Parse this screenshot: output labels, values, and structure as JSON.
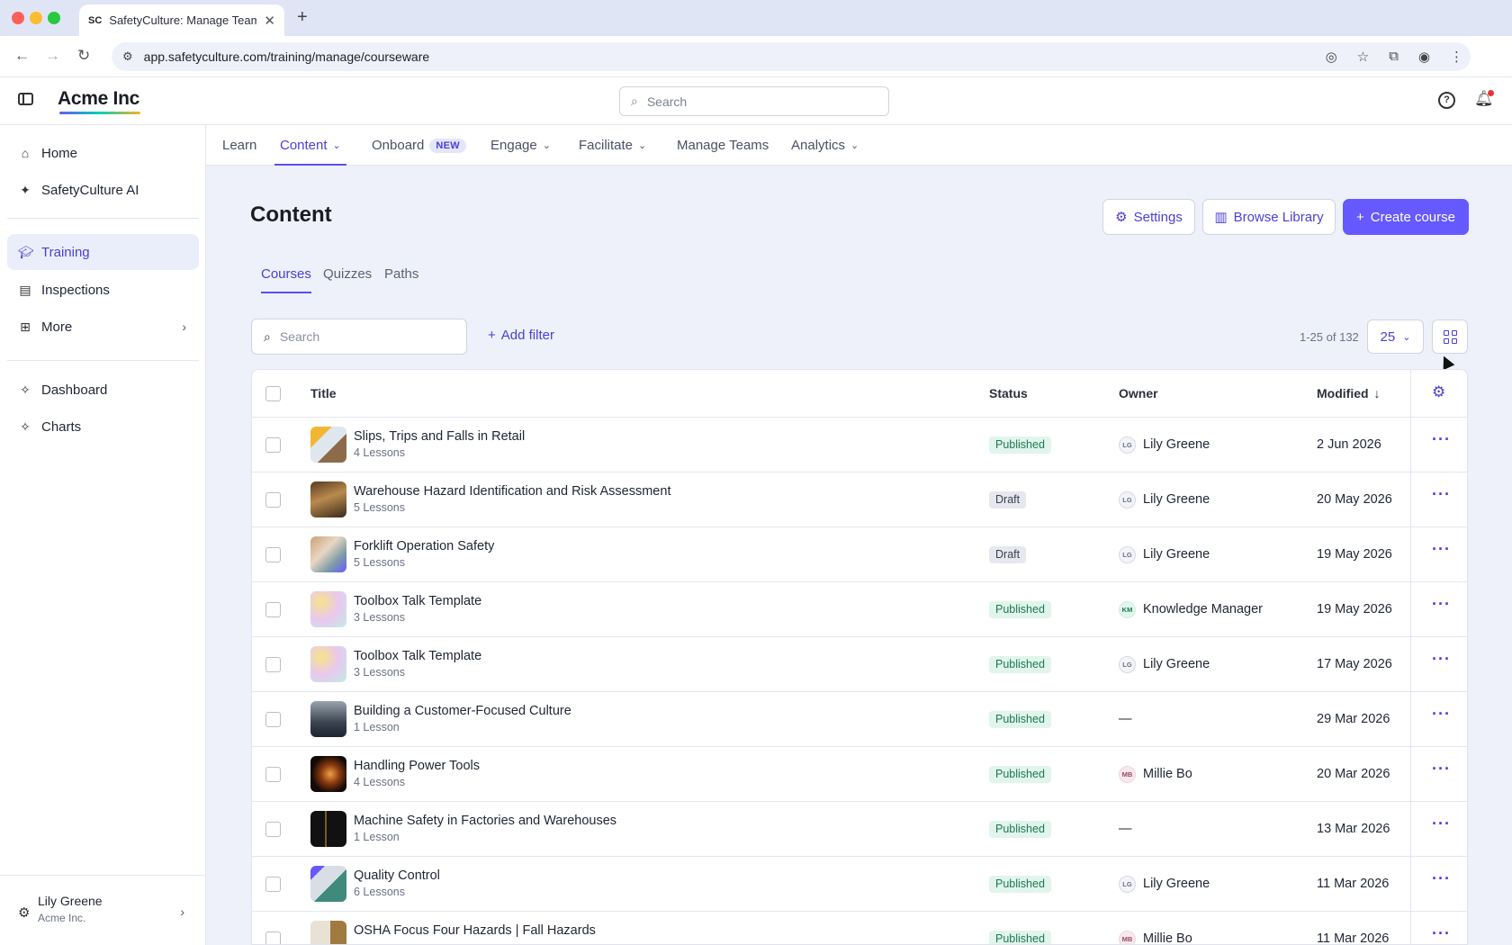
{
  "browser": {
    "tab_title": "SafetyCulture: Manage Teams",
    "favicon_text": "SC",
    "url": "app.safetyculture.com/training/manage/courseware"
  },
  "header": {
    "brand": "Acme Inc",
    "search_placeholder": "Search"
  },
  "sidebar": {
    "items": [
      {
        "label": "Home",
        "icon": "home-icon"
      },
      {
        "label": "SafetyCulture AI",
        "icon": "sparkle-icon"
      },
      {
        "label": "Training",
        "icon": "graduation-cap-icon",
        "active": true
      },
      {
        "label": "Inspections",
        "icon": "clipboard-icon"
      },
      {
        "label": "More",
        "icon": "grid-icon"
      },
      {
        "label": "Dashboard",
        "icon": "puzzle-icon"
      },
      {
        "label": "Charts",
        "icon": "puzzle-icon"
      }
    ],
    "user": {
      "name": "Lily Greene",
      "org": "Acme Inc."
    }
  },
  "topnav": {
    "learn": "Learn",
    "content": "Content",
    "onboard": "Onboard",
    "onboard_badge": "NEW",
    "engage": "Engage",
    "facilitate": "Facilitate",
    "manage_teams": "Manage Teams",
    "analytics": "Analytics"
  },
  "main": {
    "title": "Content",
    "settings_label": "Settings",
    "browse_label": "Browse Library",
    "create_label": "Create course",
    "tabs": [
      "Courses",
      "Quizzes",
      "Paths"
    ],
    "search_placeholder": "Search",
    "add_filter_label": "Add filter",
    "page_count": "1-25 of 132",
    "per_page": "25"
  },
  "table": {
    "columns": {
      "title": "Title",
      "status": "Status",
      "owner": "Owner",
      "modified": "Modified"
    },
    "rows": [
      {
        "title": "Slips, Trips and Falls in Retail",
        "lessons": "4 Lessons",
        "status": "Published",
        "owner_initials": "LG",
        "owner": "Lily Greene",
        "modified": "2 Jun 2026"
      },
      {
        "title": "Warehouse Hazard Identification and Risk Assessment",
        "lessons": "5 Lessons",
        "status": "Draft",
        "owner_initials": "LG",
        "owner": "Lily Greene",
        "modified": "20 May 2026"
      },
      {
        "title": "Forklift Operation Safety",
        "lessons": "5 Lessons",
        "status": "Draft",
        "owner_initials": "LG",
        "owner": "Lily Greene",
        "modified": "19 May 2026"
      },
      {
        "title": "Toolbox Talk Template",
        "lessons": "3 Lessons",
        "status": "Published",
        "owner_initials": "KM",
        "owner": "Knowledge Manager",
        "modified": "19 May 2026"
      },
      {
        "title": "Toolbox Talk Template",
        "lessons": "3 Lessons",
        "status": "Published",
        "owner_initials": "LG",
        "owner": "Lily Greene",
        "modified": "17 May 2026"
      },
      {
        "title": "Building a Customer-Focused Culture",
        "lessons": "1 Lesson",
        "status": "Published",
        "owner_initials": "",
        "owner": "—",
        "modified": "29 Mar 2026"
      },
      {
        "title": "Handling Power Tools",
        "lessons": "4 Lessons",
        "status": "Published",
        "owner_initials": "MB",
        "owner": "Millie Bo",
        "modified": "20 Mar 2026"
      },
      {
        "title": "Machine Safety in Factories and Warehouses",
        "lessons": "1 Lesson",
        "status": "Published",
        "owner_initials": "",
        "owner": "—",
        "modified": "13 Mar 2026"
      },
      {
        "title": "Quality Control",
        "lessons": "6 Lessons",
        "status": "Published",
        "owner_initials": "LG",
        "owner": "Lily Greene",
        "modified": "11 Mar 2026"
      },
      {
        "title": "OSHA Focus Four Hazards | Fall Hazards",
        "lessons": "",
        "status": "Published",
        "owner_initials": "MB",
        "owner": "Millie Bo",
        "modified": "11 Mar 2026"
      }
    ]
  },
  "colors": {
    "accent": "#6559ff",
    "published_bg": "#e1f5ec",
    "published_text": "#1d7a55",
    "draft_bg": "#e6e8ee"
  }
}
